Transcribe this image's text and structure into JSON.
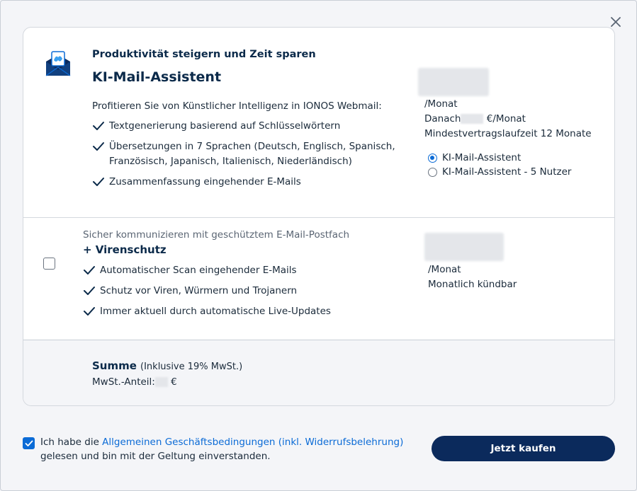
{
  "product": {
    "subtitle": "Produktivität steigern und Zeit sparen",
    "title": "KI-Mail-Assistent",
    "intro": "Profitieren Sie von Künstlicher Intelligenz in IONOS Webmail:",
    "features": [
      "Textgenerierung basierend auf Schlüsselwörtern",
      "Übersetzungen in 7 Sprachen (Deutsch, Englisch, Spanisch,",
      "Französisch, Japanisch, Italienisch, Niederländisch)",
      "Zusammenfassung eingehender E-Mails"
    ],
    "price_unit": "/Monat",
    "after_prefix": "Danach",
    "after_suffix": "€/Monat",
    "min_term": "Mindestvertragslaufzeit 12 Monate",
    "options": [
      "KI-Mail-Assistent",
      "KI-Mail-Assistent - 5 Nutzer"
    ],
    "selected_option": 0
  },
  "addon": {
    "subtitle": "Sicher kommunizieren mit geschütztem E-Mail-Postfach",
    "title": "+ Virenschutz",
    "features": [
      "Automatischer Scan eingehender E-Mails",
      "Schutz vor Viren, Würmern und Trojanern",
      "Immer aktuell durch automatische Live-Updates"
    ],
    "price_unit": "/Monat",
    "cancel_note": "Monatlich kündbar",
    "checked": false
  },
  "summary": {
    "label": "Summe",
    "tax_note": "(Inklusive 19% MwSt.)",
    "vat_label": "MwSt.-Anteil:",
    "vat_currency": "€"
  },
  "terms": {
    "prefix": "Ich habe die",
    "link": "Allgemeinen Geschäftsbedingungen (inkl. Widerrufsbelehrung)",
    "suffix": "gelesen und bin mit der Geltung einverstanden.",
    "checked": true
  },
  "buy_label": "Jetzt kaufen",
  "colors": {
    "primary": "#0b2a5c",
    "accent": "#0b6bd6",
    "text": "#1a2a3a"
  }
}
